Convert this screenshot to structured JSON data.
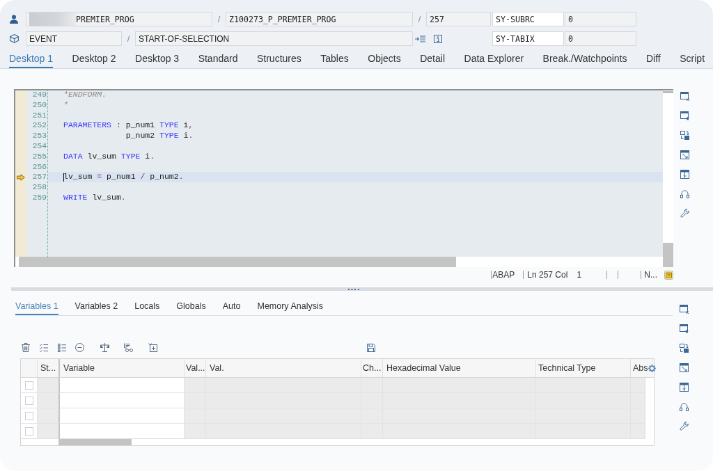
{
  "context": {
    "rows": [
      {
        "parts": [
          {
            "kind": "field",
            "value": "PREMIER_PROG",
            "redacted": true
          },
          {
            "kind": "separator",
            "text": "/"
          },
          {
            "kind": "field",
            "value": "Z100273_P_PREMIER_PROG",
            "redacted": false
          },
          {
            "kind": "separator",
            "text": "/"
          },
          {
            "kind": "field",
            "value": "257",
            "redacted": false
          }
        ],
        "system_field": {
          "name": "SY-SUBRC",
          "value": "0"
        }
      },
      {
        "parts": [
          {
            "kind": "field",
            "value": "EVENT",
            "redacted": false
          },
          {
            "kind": "separator",
            "text": "/"
          },
          {
            "kind": "field",
            "value": "START-OF-SELECTION",
            "redacted": false
          }
        ],
        "system_field": {
          "name": "SY-TABIX",
          "value": "0"
        }
      }
    ]
  },
  "tabs": [
    {
      "label": "Desktop 1",
      "selected": true
    },
    {
      "label": "Desktop 2",
      "selected": false
    },
    {
      "label": "Desktop 3",
      "selected": false
    },
    {
      "label": "Standard",
      "selected": false
    },
    {
      "label": "Structures",
      "selected": false
    },
    {
      "label": "Tables",
      "selected": false
    },
    {
      "label": "Objects",
      "selected": false
    },
    {
      "label": "Detail",
      "selected": false
    },
    {
      "label": "Data Explorer",
      "selected": false
    },
    {
      "label": "Break./Watchpoints",
      "selected": false
    },
    {
      "label": "Diff",
      "selected": false
    },
    {
      "label": "Script",
      "selected": false
    }
  ],
  "editor": {
    "lines": [
      {
        "number": "249",
        "current": false,
        "tokens": [
          {
            "kind": "comment",
            "text": "*ENDFORM."
          }
        ]
      },
      {
        "number": "250",
        "current": false,
        "tokens": [
          {
            "kind": "comment",
            "text": "*"
          }
        ]
      },
      {
        "number": "251",
        "current": false
      },
      {
        "number": "252",
        "current": false,
        "tokens": [
          {
            "kind": "keyword",
            "text": "PARAMETERS"
          },
          {
            "kind": "operator",
            "text": " :"
          },
          {
            "kind": "text",
            "text": " p_num1 "
          },
          {
            "kind": "keyword",
            "text": "TYPE"
          },
          {
            "kind": "text",
            "text": " i"
          },
          {
            "kind": "operator",
            "text": ","
          }
        ]
      },
      {
        "number": "253",
        "current": false,
        "tokens": [
          {
            "kind": "text",
            "text": "             p_num2 "
          },
          {
            "kind": "keyword",
            "text": "TYPE"
          },
          {
            "kind": "text",
            "text": " i"
          },
          {
            "kind": "operator",
            "text": "."
          }
        ]
      },
      {
        "number": "254",
        "current": false
      },
      {
        "number": "255",
        "current": false,
        "tokens": [
          {
            "kind": "keyword",
            "text": "DATA"
          },
          {
            "kind": "text",
            "text": " lv_sum "
          },
          {
            "kind": "keyword",
            "text": "TYPE"
          },
          {
            "kind": "text",
            "text": " i"
          },
          {
            "kind": "operator",
            "text": "."
          }
        ]
      },
      {
        "number": "256",
        "current": false
      },
      {
        "number": "257",
        "current": true,
        "tokens": [
          {
            "kind": "text",
            "text": "lv_sum "
          },
          {
            "kind": "operator",
            "text": "="
          },
          {
            "kind": "text",
            "text": " p_num1 "
          },
          {
            "kind": "operator",
            "text": "/"
          },
          {
            "kind": "text",
            "text": " p_num2"
          },
          {
            "kind": "operator",
            "text": "."
          }
        ]
      },
      {
        "number": "258",
        "current": false
      },
      {
        "number": "259",
        "current": false,
        "tokens": [
          {
            "kind": "keyword",
            "text": "WRITE"
          },
          {
            "kind": "text",
            "text": " lv_sum"
          },
          {
            "kind": "operator",
            "text": "."
          }
        ]
      }
    ],
    "status_bar": {
      "language": "ABAP",
      "position": "Ln 257 Col",
      "column": "1",
      "mode": "N..."
    }
  },
  "variables": {
    "tabs": [
      {
        "label": "Variables 1",
        "selected": true
      },
      {
        "label": "Variables 2",
        "selected": false
      },
      {
        "label": "Locals",
        "selected": false
      },
      {
        "label": "Globals",
        "selected": false
      },
      {
        "label": "Auto",
        "selected": false
      },
      {
        "label": "Memory Analysis",
        "selected": false
      }
    ],
    "table": {
      "columns": [
        "St...",
        "Variable",
        "Val...",
        "Val.",
        "Ch...",
        "Hexadecimal Value",
        "Technical Type",
        "Abs"
      ],
      "rows": [
        {
          "checked": false
        },
        {
          "checked": false
        },
        {
          "checked": false
        },
        {
          "checked": false
        }
      ]
    }
  }
}
